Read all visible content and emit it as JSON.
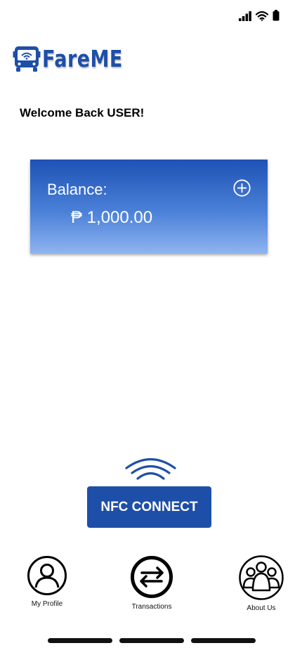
{
  "app": {
    "name": "FareME",
    "brand_color": "#1e4fa8"
  },
  "status_bar": {
    "icons": [
      "cellular-signal-icon",
      "wifi-icon",
      "battery-icon"
    ]
  },
  "header": {
    "logo_icon": "bus-nfc-icon",
    "logo_text": "FareME"
  },
  "welcome": {
    "text": "Welcome Back USER!"
  },
  "balance": {
    "label": "Balance:",
    "amount": "₱ 1,000.00",
    "add_icon": "plus-circle-icon",
    "gradient_top": "#1e52b5",
    "gradient_bottom": "#8fb4f0"
  },
  "nfc": {
    "icon": "nfc-waves-icon",
    "button_label": "NFC CONNECT"
  },
  "bottom_nav": {
    "items": [
      {
        "label": "My Profile",
        "icon": "user-circle-icon"
      },
      {
        "label": "Transactions",
        "icon": "transfer-arrows-icon"
      },
      {
        "label": "About Us",
        "icon": "group-icon"
      }
    ]
  }
}
